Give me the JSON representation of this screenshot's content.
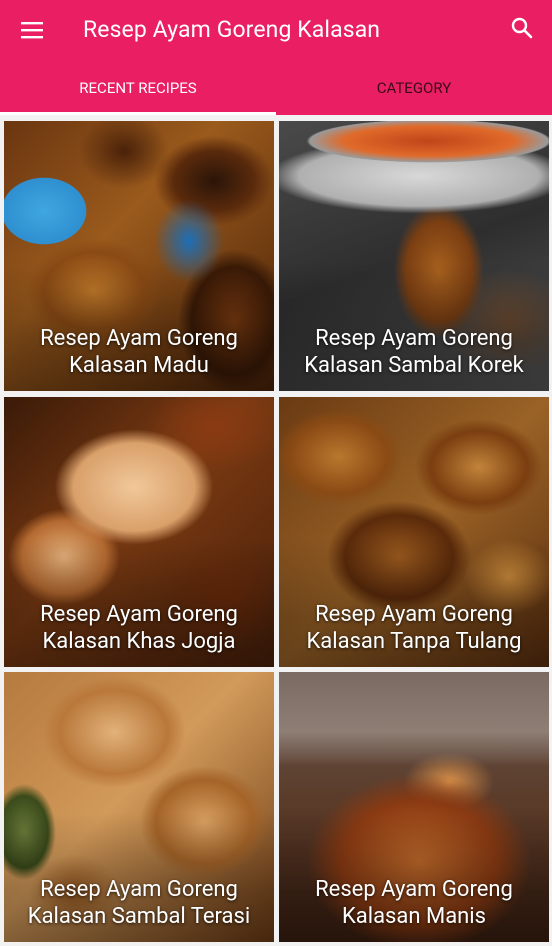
{
  "app": {
    "title": "Resep Ayam Goreng Kalasan",
    "colors": {
      "primary": "#e91e63",
      "tab_active_text": "#ffffff",
      "tab_inactive_text": "#3a0a1a"
    },
    "icons": {
      "menu": "hamburger-menu-icon",
      "search": "search-icon"
    }
  },
  "tabs": [
    {
      "label": "RECENT RECIPES",
      "active": true
    },
    {
      "label": "CATEGORY",
      "active": false
    }
  ],
  "recipes": [
    {
      "title": "Resep Ayam Goreng Kalasan Madu"
    },
    {
      "title": "Resep Ayam Goreng Kalasan Sambal Korek"
    },
    {
      "title": "Resep Ayam Goreng Kalasan Khas Jogja"
    },
    {
      "title": "Resep Ayam Goreng Kalasan Tanpa Tulang"
    },
    {
      "title": "Resep Ayam Goreng Kalasan Sambal Terasi"
    },
    {
      "title": "Resep Ayam Goreng Kalasan Manis"
    }
  ]
}
